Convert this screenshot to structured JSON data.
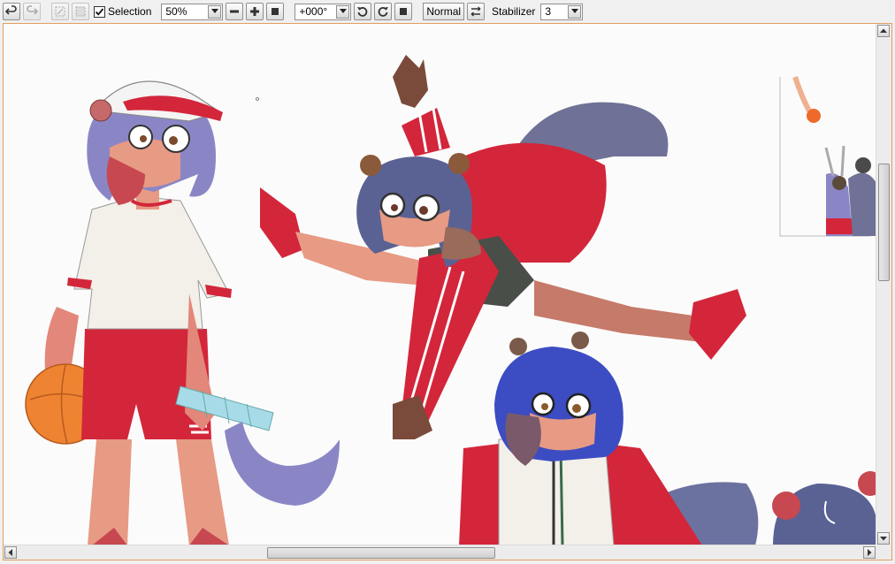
{
  "toolbar": {
    "selection_label": "Selection",
    "selection_checked": true,
    "zoom_value": "50%",
    "rotation_value": "+000°",
    "blend_mode_label": "Normal",
    "stabilizer_label": "Stabilizer",
    "stabilizer_value": "3"
  },
  "icons": {
    "undo": "undo-icon",
    "redo": "redo-icon",
    "deselect": "deselect-icon",
    "invert": "invert-selection-icon",
    "zoom_out": "minus-icon",
    "zoom_in": "plus-icon",
    "zoom_reset": "square-icon",
    "rotate_ccw": "rotate-ccw-icon",
    "rotate_cw": "rotate-cw-icon",
    "rotate_reset": "square-icon",
    "flip": "flip-horizontal-icon"
  },
  "colors": {
    "red": "#d3263a",
    "white_shirt": "#f3efe9",
    "skin": "#e79a84",
    "hair_blue": "#4a56a8",
    "tail_grey": "#6f7296",
    "ball_orange": "#ee8331",
    "bottle": "#a8dbe8",
    "frame_border": "#e0a060"
  }
}
